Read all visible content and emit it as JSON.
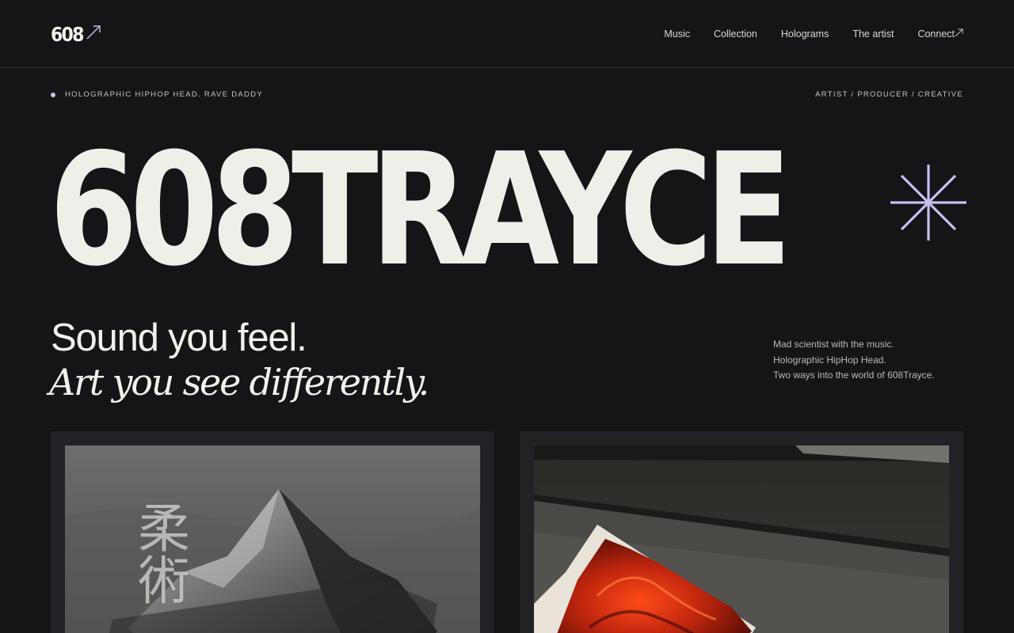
{
  "header": {
    "logo": "608",
    "nav": [
      {
        "label": "Music"
      },
      {
        "label": "Collection"
      },
      {
        "label": "Holograms"
      },
      {
        "label": "The artist"
      },
      {
        "label": "Connect"
      }
    ]
  },
  "meta": {
    "left": "HOLOGRAPHIC HIPHOP HEAD. RAVE DADDY",
    "right": "ARTIST / PRODUCER / CREATIVE"
  },
  "hero": {
    "title": "608TRAYCE",
    "accent_color": "#c9bff2"
  },
  "tagline": {
    "line1": "Sound you feel.",
    "line2": "Art you see differently."
  },
  "blurb": {
    "lines": [
      "Mad scientist with the music.",
      "Holographic HipHop Head.",
      "Two ways into the world of 608Trayce."
    ]
  },
  "cards": {
    "left": {
      "overlay_text": "柔術",
      "icon": "mountain-artwork"
    },
    "right": {
      "icon": "red-hologram-artwork"
    }
  }
}
